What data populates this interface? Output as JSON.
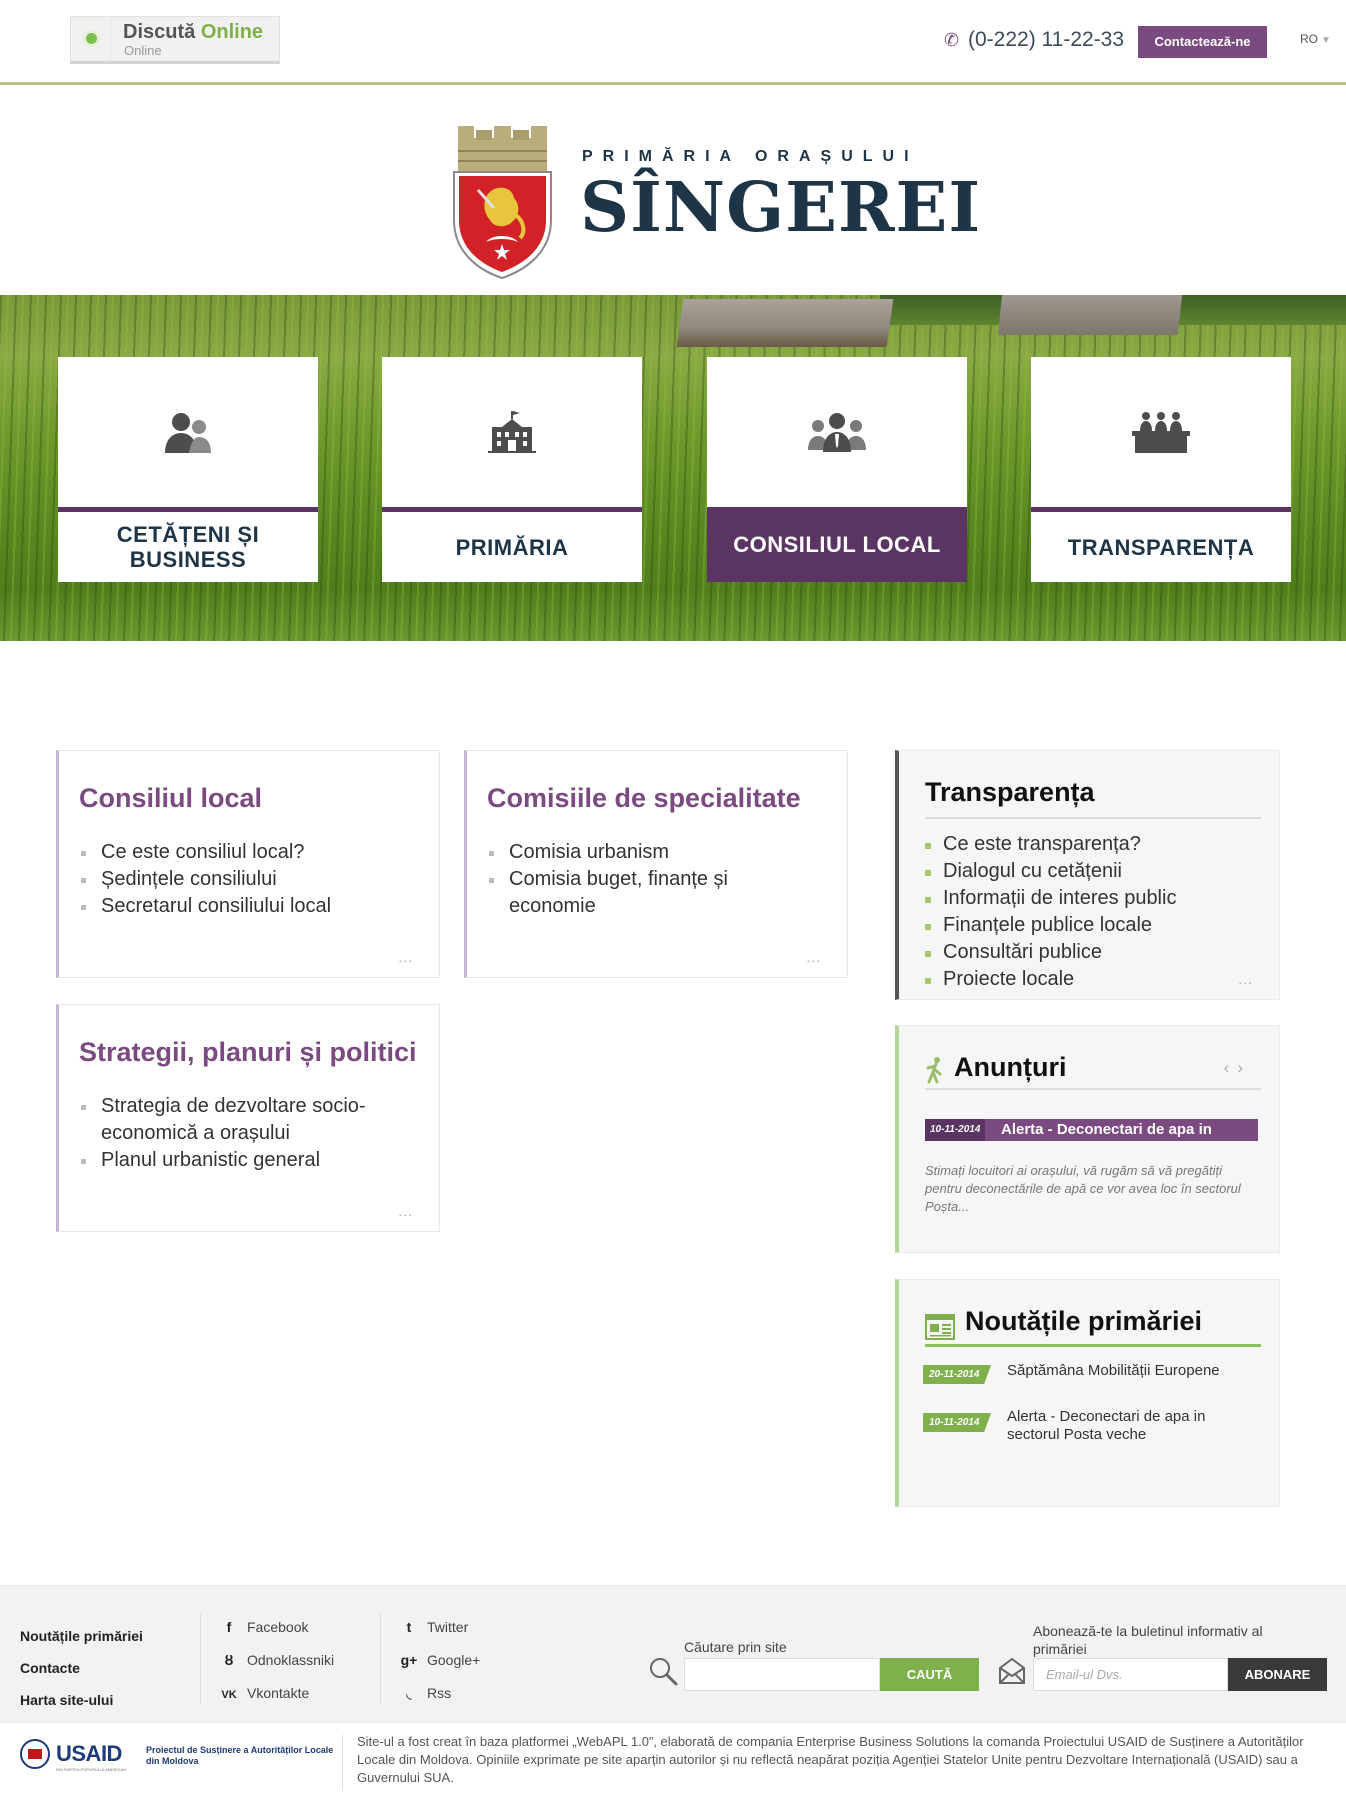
{
  "header": {
    "chat_title_a": "Discută",
    "chat_title_b": "Online",
    "chat_status": "Online",
    "phone": "(0-222) 11-22-33",
    "contact_button": "Contactează-ne",
    "language": "RO"
  },
  "logo": {
    "subtitle": "PRIMĂRIA ORAȘULUI",
    "title": "SÎNGEREI"
  },
  "tiles": [
    {
      "label": "CETĂȚENI ȘI BUSINESS",
      "icon": "citizens-icon",
      "active": false
    },
    {
      "label": "PRIMĂRIA",
      "icon": "city-hall-icon",
      "active": false
    },
    {
      "label": "CONSILIUL LOCAL",
      "icon": "council-icon",
      "active": true
    },
    {
      "label": "TRANSPARENȚA",
      "icon": "meeting-table-icon",
      "active": false
    }
  ],
  "cards": {
    "consiliu": {
      "title": "Consiliul local",
      "items": [
        "Ce este consiliul local?",
        "Ședințele consiliului",
        "Secretarul consiliului local"
      ]
    },
    "comisii": {
      "title": "Comisiile de specialitate",
      "items": [
        "Comisia urbanism",
        "Comisia buget, finanțe și economie"
      ]
    },
    "strategii": {
      "title": "Strategii, planuri și politici",
      "items": [
        "Strategia de dezvoltare socio-economică a orașului",
        "Planul urbanistic general"
      ]
    },
    "more": "..."
  },
  "sidebar": {
    "transparenta": {
      "title": "Transparența",
      "items": [
        "Ce este transparența?",
        "Dialogul cu cetățenii",
        "Informații de interes public",
        "Finanțele publice locale",
        "Consultări publice",
        "Proiecte locale"
      ]
    },
    "anunturi": {
      "title": "Anunțuri",
      "prev": "‹",
      "next": "›",
      "item_date": "10-11-2014",
      "item_title": "Alerta - Deconectari de apa in",
      "item_text": "Stimați locuitori ai orașului, vă rugăm să vă pregătiți pentru deconectările de apă ce vor avea loc în sectorul Poșta..."
    },
    "noutati": {
      "title": "Noutățile primăriei",
      "items": [
        {
          "date": "20-11-2014",
          "title": "Săptămâna Mobilității Europene"
        },
        {
          "date": "10-11-2014",
          "title": "Alerta - Deconectari de apa in sectorul Posta veche"
        }
      ]
    }
  },
  "footer": {
    "links": [
      "Noutățile primăriei",
      "Contacte",
      "Harta site-ului"
    ],
    "social_a": [
      {
        "icon": "facebook-icon",
        "glyph": "f",
        "label": "Facebook"
      },
      {
        "icon": "odnoklassniki-icon",
        "glyph": "ȣ",
        "label": "Odnoklassniki"
      },
      {
        "icon": "vkontakte-icon",
        "glyph": "VK",
        "label": "Vkontakte"
      }
    ],
    "social_b": [
      {
        "icon": "twitter-icon",
        "glyph": "t",
        "label": "Twitter"
      },
      {
        "icon": "google-plus-icon",
        "glyph": "g+",
        "label": "Google+"
      },
      {
        "icon": "rss-icon",
        "glyph": "◟",
        "label": "Rss"
      }
    ],
    "search_label": "Căutare prin site",
    "search_button": "CAUTĂ",
    "newsletter_label": "Abonează-te la buletinul informativ al primăriei",
    "newsletter_placeholder": "Email-ul Dvs.",
    "newsletter_button": "ABONARE"
  },
  "credits": {
    "usaid": "USAID",
    "usaid_small": "DIN PARTEA POPORULUI AMERICAN",
    "project": "Proiectul de Susținere a Autorităților Locale din Moldova",
    "text": "Site-ul a fost creat în baza platformei „WebAPL 1.0”, elaborată de compania Enterprise Business Solutions la comanda Proiectului USAID de Susținere a Autorităților Locale din Moldova. Opiniile exprimate pe site aparțin autorilor și nu reflectă neapărat poziția Agenției Statelor Unite pentru Dezvoltare Internațională (USAID) sau a Guvernului SUA."
  },
  "colors": {
    "accent_purple": "#7b4a80",
    "dark_purple": "#5a3463",
    "accent_green": "#7fb04c",
    "navy": "#1e3447"
  }
}
